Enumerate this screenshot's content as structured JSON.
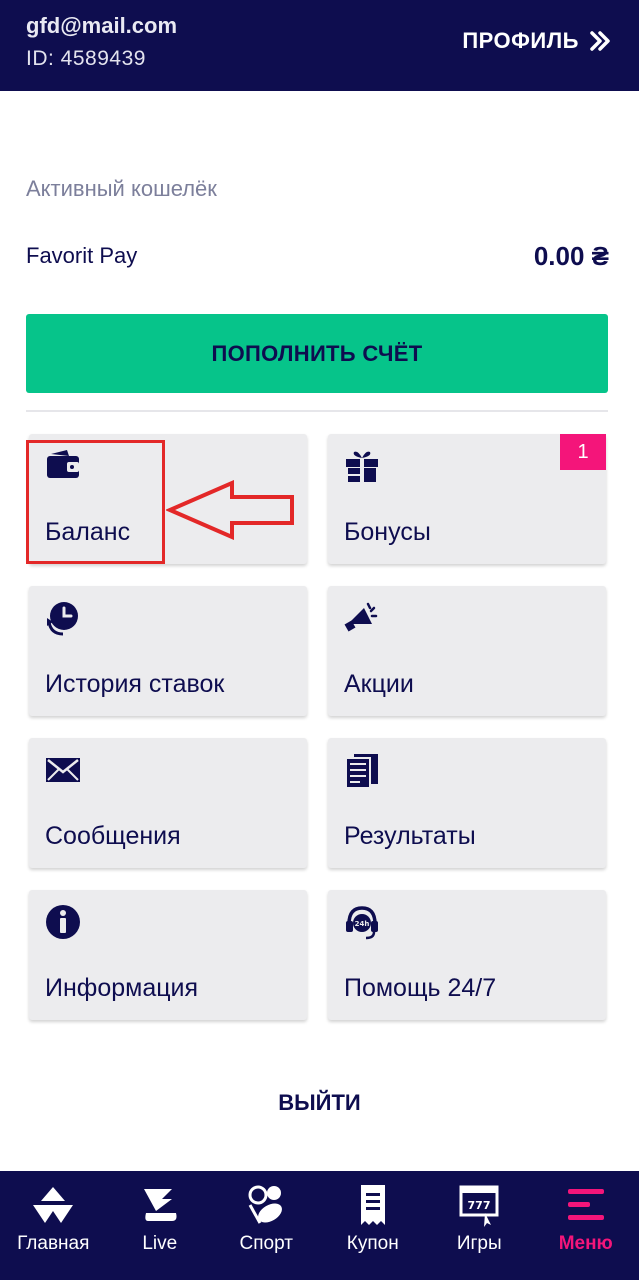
{
  "header": {
    "email": "gfd@mail.com",
    "user_id": "ID: 4589439",
    "profile_label": "ПРОФИЛЬ",
    "profile_icon": "double-chevron-right-icon"
  },
  "wallet": {
    "caption": "Активный кошелёк",
    "name": "Favorit Pay",
    "amount": "0.00 ₴"
  },
  "deposit_button": {
    "label": "ПОПОЛНИТЬ СЧЁТ"
  },
  "tiles": [
    {
      "label": "Баланс",
      "icon": "wallet-icon"
    },
    {
      "label": "Бонусы",
      "icon": "gift-icon",
      "badge": "1"
    },
    {
      "label": "История ставок",
      "icon": "history-clock-icon"
    },
    {
      "label": "Акции",
      "icon": "megaphone-icon"
    },
    {
      "label": "Сообщения",
      "icon": "envelope-icon"
    },
    {
      "label": "Результаты",
      "icon": "results-sheet-icon"
    },
    {
      "label": "Информация",
      "icon": "info-icon"
    },
    {
      "label": "Помощь 24/7",
      "icon": "support-headset-icon"
    }
  ],
  "logout_label": "ВЫЙТИ",
  "bottom_nav": [
    {
      "label": "Главная",
      "icon": "home-logo-icon"
    },
    {
      "label": "Live",
      "icon": "running-shoe-icon"
    },
    {
      "label": "Спорт",
      "icon": "sports-balls-icon"
    },
    {
      "label": "Купон",
      "icon": "coupon-icon"
    },
    {
      "label": "Игры",
      "icon": "slot-machine-icon"
    },
    {
      "label": "Меню",
      "icon": "menu-icon",
      "active": true
    }
  ],
  "colors": {
    "navy": "#0e0d4f",
    "green": "#06c48a",
    "pink": "#f4157a",
    "tile": "#ececee",
    "annotation_red": "#e32828"
  }
}
